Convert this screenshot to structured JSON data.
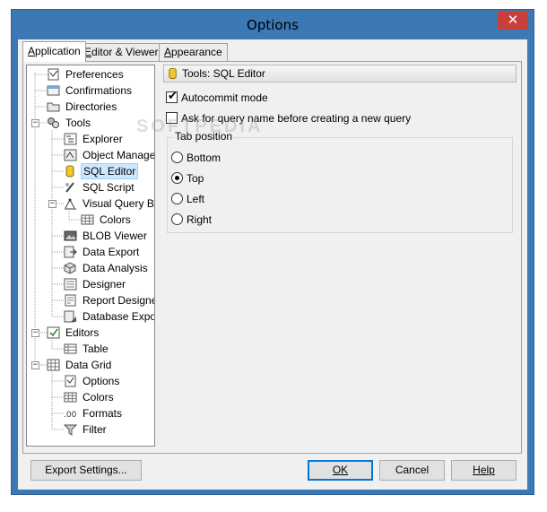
{
  "window": {
    "title": "Options",
    "close_glyph": "✕"
  },
  "tabs": [
    {
      "label": "Application",
      "underline": "A",
      "rest": "pplication",
      "active": true
    },
    {
      "label": "Editor & Viewers",
      "underline": "E",
      "rest": "ditor & Viewers",
      "active": false
    },
    {
      "label": "Appearance",
      "underline": "A",
      "rest": "ppearance",
      "active": false
    }
  ],
  "tree": [
    {
      "label": "Preferences",
      "icon": "preferences-icon"
    },
    {
      "label": "Confirmations",
      "icon": "confirmations-icon"
    },
    {
      "label": "Directories",
      "icon": "directories-icon"
    },
    {
      "label": "Tools",
      "icon": "tools-icon",
      "expanded": true
    },
    {
      "label": "Explorer",
      "icon": "explorer-icon"
    },
    {
      "label": "Object Manager",
      "icon": "object-manager-icon"
    },
    {
      "label": "SQL Editor",
      "icon": "sql-editor-icon",
      "selected": true
    },
    {
      "label": "SQL Script",
      "icon": "sql-script-icon"
    },
    {
      "label": "Visual Query Builder",
      "icon": "visual-query-builder-icon",
      "expanded": true
    },
    {
      "label": "Colors",
      "icon": "colors-icon"
    },
    {
      "label": "BLOB Viewer",
      "icon": "blob-viewer-icon"
    },
    {
      "label": "Data Export",
      "icon": "data-export-icon"
    },
    {
      "label": "Data Analysis",
      "icon": "data-analysis-icon"
    },
    {
      "label": "Designer",
      "icon": "designer-icon"
    },
    {
      "label": "Report Designer",
      "icon": "report-designer-icon"
    },
    {
      "label": "Database Export",
      "icon": "database-export-icon"
    },
    {
      "label": "Editors",
      "icon": "editors-icon",
      "expanded": true
    },
    {
      "label": "Table",
      "icon": "table-icon"
    },
    {
      "label": "Data Grid",
      "icon": "data-grid-icon",
      "expanded": true
    },
    {
      "label": "Options",
      "icon": "options-icon"
    },
    {
      "label": "Colors",
      "icon": "colors-icon"
    },
    {
      "label": "Formats",
      "icon": "formats-icon"
    },
    {
      "label": "Filter",
      "icon": "filter-icon"
    }
  ],
  "panel": {
    "header": "Tools: SQL Editor",
    "autocommit": {
      "label": "Autocommit mode",
      "checked": true
    },
    "ask_query_name": {
      "label": "Ask for query name before creating a new query",
      "checked": false
    },
    "tab_position": {
      "legend": "Tab position",
      "options": [
        "Bottom",
        "Top",
        "Left",
        "Right"
      ],
      "selected": "Top"
    }
  },
  "buttons": {
    "export": "Export Settings...",
    "ok": "OK",
    "cancel": "Cancel",
    "help": "Help"
  },
  "watermark": "SOFTPEDIA"
}
